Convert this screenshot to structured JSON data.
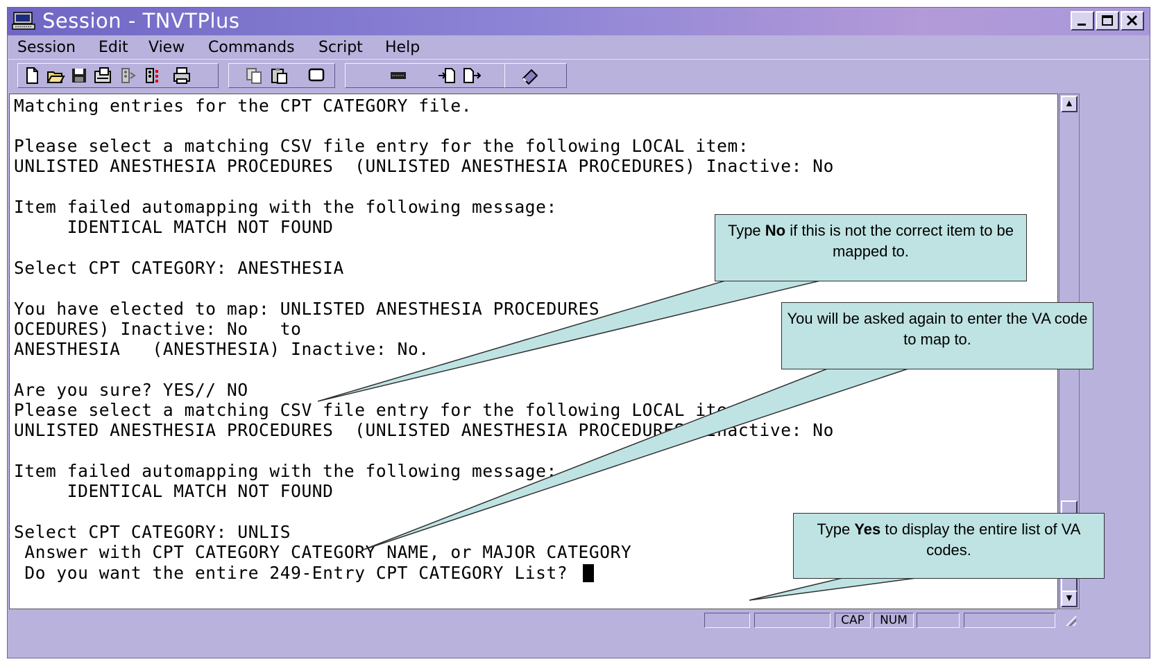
{
  "window": {
    "title": "Session - TNVTPlus"
  },
  "menu": [
    "Session",
    "Edit",
    "View",
    "Commands",
    "Script",
    "Help"
  ],
  "toolbar_icons": [
    "new-icon",
    "open-icon",
    "save-icon",
    "properties-icon",
    "connect-icon",
    "disconnect-icon",
    "print-icon",
    "copy-icon",
    "paste-icon",
    "screen-icon",
    "keyboard-icon",
    "receive-icon",
    "send-icon",
    "script-icon"
  ],
  "terminal": {
    "lines": [
      "Matching entries for the CPT CATEGORY file.",
      "",
      "Please select a matching CSV file entry for the following LOCAL item:",
      "UNLISTED ANESTHESIA PROCEDURES  (UNLISTED ANESTHESIA PROCEDURES) Inactive: No",
      "",
      "Item failed automapping with the following message:",
      "     IDENTICAL MATCH NOT FOUND",
      "",
      "Select CPT CATEGORY: ANESTHESIA",
      "",
      "You have elected to map: UNLISTED ANESTHESIA PROCEDURES",
      "OCEDURES) Inactive: No   to",
      "ANESTHESIA   (ANESTHESIA) Inactive: No.",
      "",
      "Are you sure? YES// NO",
      "Please select a matching CSV file entry for the following LOCAL item:",
      "UNLISTED ANESTHESIA PROCEDURES  (UNLISTED ANESTHESIA PROCEDURES) Inactive: No",
      "",
      "Item failed automapping with the following message:",
      "     IDENTICAL MATCH NOT FOUND",
      "",
      "Select CPT CATEGORY: UNLIS",
      " Answer with CPT CATEGORY CATEGORY NAME, or MAJOR CATEGORY",
      " Do you want the entire 249-Entry CPT CATEGORY List? "
    ]
  },
  "status": {
    "cap": "CAP",
    "num": "NUM"
  },
  "callouts": {
    "no": {
      "pre": "Type ",
      "bold": "No",
      "post": " if this is not the correct item to be mapped to."
    },
    "again": {
      "text": "You will be asked again to enter the VA code to map to."
    },
    "yes": {
      "pre": "Type ",
      "bold": "Yes",
      "post": " to display the entire list of VA codes."
    }
  }
}
